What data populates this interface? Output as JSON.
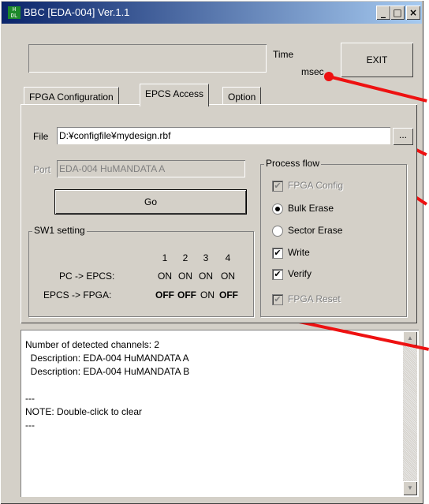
{
  "window": {
    "icon_text": "H\nDL",
    "title": "BBC [EDA-004] Ver.1.1",
    "controls": {
      "minimize": "_",
      "maximize": "□",
      "close": "×"
    }
  },
  "status": {
    "time_label": "Time",
    "unit_label": "msec"
  },
  "exit_label": "EXIT",
  "tabs": [
    {
      "label": "FPGA Configuration"
    },
    {
      "label": "EPCS Access"
    },
    {
      "label": "Option"
    }
  ],
  "file": {
    "label": "File",
    "value": "D:¥configfile¥mydesign.rbf",
    "browse_label": "..."
  },
  "port": {
    "label": "Port",
    "value": "EDA-004 HuMANDATA A"
  },
  "go_label": "Go",
  "sw1": {
    "title": "SW1 setting",
    "headers": [
      "1",
      "2",
      "3",
      "4"
    ],
    "rows": [
      {
        "label": "PC -> EPCS:",
        "values": [
          "ON",
          "ON",
          "ON",
          "ON"
        ],
        "bold": [
          false,
          false,
          false,
          false
        ]
      },
      {
        "label": "EPCS -> FPGA:",
        "values": [
          "OFF",
          "OFF",
          "ON",
          "OFF"
        ],
        "bold": [
          true,
          true,
          false,
          true
        ]
      }
    ]
  },
  "process_flow": {
    "title": "Process flow",
    "fpga_config": {
      "label": "FPGA Config",
      "checked": true,
      "enabled": false
    },
    "bulk_erase": {
      "label": "Bulk Erase",
      "selected": true
    },
    "sector_erase": {
      "label": "Sector Erase",
      "selected": false
    },
    "write": {
      "label": "Write",
      "checked": true
    },
    "verify": {
      "label": "Verify",
      "checked": true
    },
    "fpga_reset": {
      "label": "FPGA Reset",
      "checked": true,
      "enabled": false
    }
  },
  "log": {
    "lines": [
      "Number of detected channels: 2",
      "  Description: EDA-004 HuMANDATA A",
      "  Description: EDA-004 HuMANDATA B",
      "",
      "---",
      "NOTE: Double-click to clear",
      "---"
    ]
  },
  "colors": {
    "annotation": "#ee1111",
    "face": "#d4d0c8",
    "title_active": "#0a246a"
  },
  "icons": {
    "check": "✔",
    "scroll_up": "▲",
    "scroll_down": "▼"
  }
}
